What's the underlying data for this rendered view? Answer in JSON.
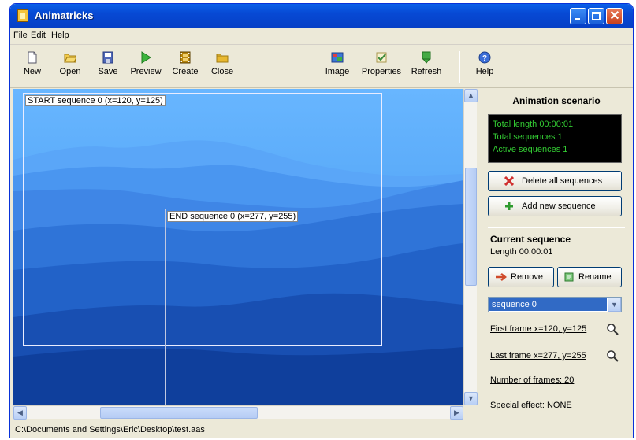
{
  "window": {
    "title": "Animatricks"
  },
  "menu": [
    {
      "label": "File",
      "accel": "F",
      "rest": "ile"
    },
    {
      "label": "Edit",
      "accel": "E",
      "rest": "dit"
    },
    {
      "label": "Help",
      "accel": "H",
      "rest": "elp"
    }
  ],
  "toolbar": {
    "new": "New",
    "open": "Open",
    "save": "Save",
    "preview": "Preview",
    "create": "Create",
    "close": "Close",
    "image": "Image",
    "properties": "Properties",
    "refresh": "Refresh",
    "help": "Help"
  },
  "canvas": {
    "start_label": "START sequence 0 (x=120, y=125)",
    "end_label": "END sequence 0 (x=277, y=255)"
  },
  "panel": {
    "title": "Animation scenario",
    "info": {
      "total_length": "Total length 00:00:01",
      "total_sequences": "Total sequences 1",
      "active_sequences": "Active sequences 1"
    },
    "delete_all": "Delete all sequences",
    "add_new": "Add new sequence",
    "current_title": "Current sequence",
    "current_length": "Length 00:00:01",
    "remove": "Remove",
    "rename": "Rename",
    "selected_sequence": "sequence 0",
    "first_frame": "First frame x=120, y=125",
    "last_frame": "Last frame x=277, y=255",
    "number_of_frames": "Number of frames: 20",
    "special_effect": "Special effect: NONE"
  },
  "status": {
    "path": "C:\\Documents and Settings\\Eric\\Desktop\\test.aas"
  },
  "colors": {
    "title_bar": "#0749d4",
    "info_text": "#33cc33",
    "selection": "#316ac5"
  }
}
